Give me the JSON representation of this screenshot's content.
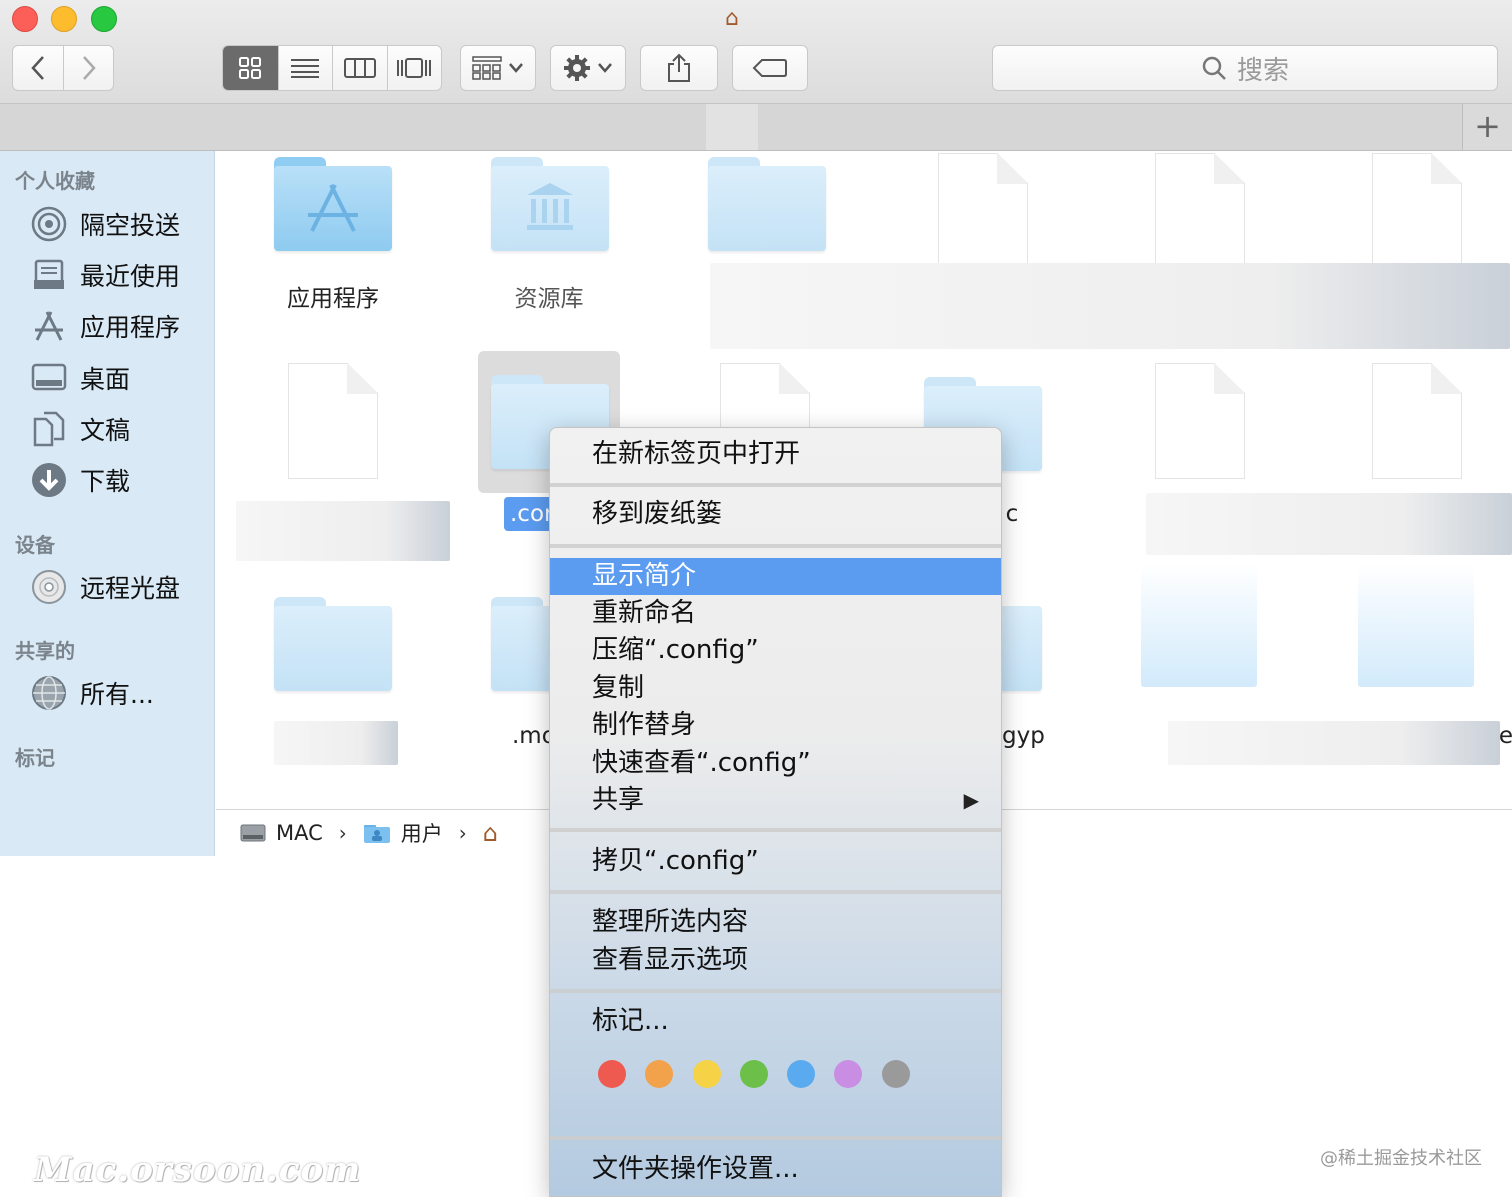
{
  "toolbar": {
    "search_placeholder": "搜索"
  },
  "sidebar": {
    "favorites_header": "个人收藏",
    "favorites": [
      {
        "label": "隔空投送",
        "icon": "airdrop-icon"
      },
      {
        "label": "最近使用",
        "icon": "recents-icon"
      },
      {
        "label": "应用程序",
        "icon": "applications-icon"
      },
      {
        "label": "桌面",
        "icon": "desktop-icon"
      },
      {
        "label": "文稿",
        "icon": "documents-icon"
      },
      {
        "label": "下载",
        "icon": "downloads-icon"
      }
    ],
    "devices_header": "设备",
    "devices": [
      {
        "label": "远程光盘",
        "icon": "disc-icon"
      }
    ],
    "shared_header": "共享的",
    "shared": [
      {
        "label": "所有...",
        "icon": "network-icon"
      }
    ],
    "tags_header": "标记"
  },
  "content": {
    "labels": {
      "applications": "应用程序",
      "library": "资源库",
      "selected_partial": ".cor",
      "partial_c": "c",
      "partial_mo": ".mo",
      "partial_gyp": "gyp",
      "partial_e": "e"
    }
  },
  "pathbar": {
    "items": [
      "MAC",
      "用户"
    ]
  },
  "context_menu": {
    "items": [
      "在新标签页中打开",
      "移到废纸篓",
      "显示简介",
      "重新命名",
      "压缩“.config”",
      "复制",
      "制作替身",
      "快速查看“.config”",
      "共享",
      "拷贝“.config”",
      "整理所选内容",
      "查看显示选项",
      "标记...",
      "文件夹操作设置..."
    ],
    "highlighted_item": "显示简介",
    "tag_colors": [
      "#ee5a4f",
      "#f1a24a",
      "#f5d246",
      "#6cc04a",
      "#5aaaf0",
      "#c98ee3",
      "#9a9a9a"
    ]
  },
  "watermarks": {
    "left": "Mac.orsoon.com",
    "right": "@稀土掘金技术社区"
  }
}
